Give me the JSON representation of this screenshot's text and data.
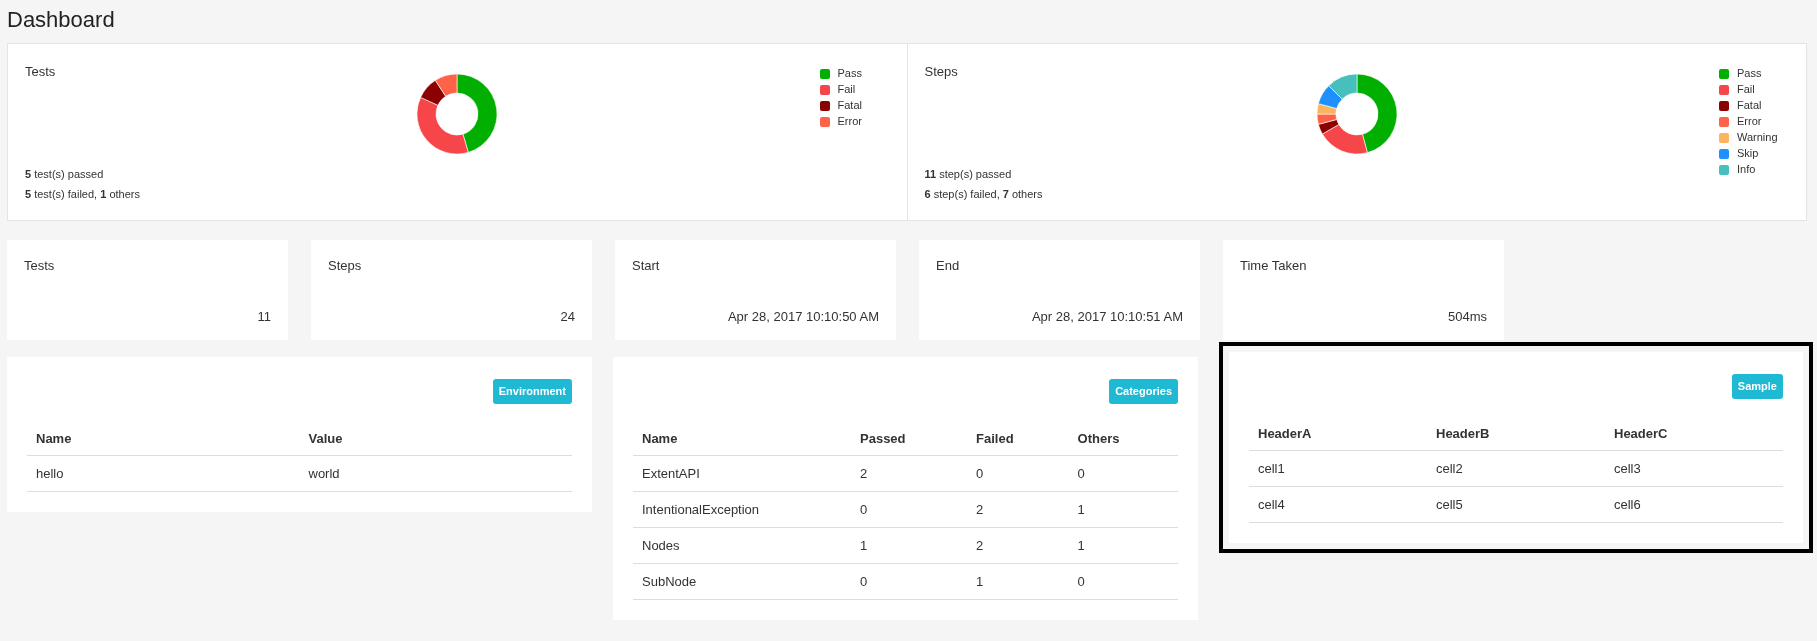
{
  "page_title": "Dashboard",
  "charts": [
    {
      "title": "Tests",
      "summary": [
        "**5** test(s) passed",
        "**5** test(s) failed, **1** others"
      ],
      "chart_data": {
        "type": "donut",
        "categories": [
          "Pass",
          "Fail",
          "Fatal",
          "Error"
        ],
        "values": [
          45.45,
          36.37,
          9.09,
          9.09
        ],
        "colors": [
          "#00af00",
          "#f7464a",
          "#8b0000",
          "#ff6347"
        ]
      }
    },
    {
      "title": "Steps",
      "summary": [
        "**11** step(s) passed",
        "**6** step(s) failed, **7** others"
      ],
      "chart_data": {
        "type": "donut",
        "categories": [
          "Pass",
          "Fail",
          "Fatal",
          "Error",
          "Warning",
          "Skip",
          "Info"
        ],
        "values": [
          45.83,
          20.83,
          4.17,
          4.17,
          4.17,
          8.33,
          12.5
        ],
        "colors": [
          "#00af00",
          "#f7464a",
          "#8b0000",
          "#ff6347",
          "#fdb45c",
          "#1e90ff",
          "#46bfbd"
        ]
      }
    }
  ],
  "stats": [
    {
      "label": "Tests",
      "value": "11"
    },
    {
      "label": "Steps",
      "value": "24"
    },
    {
      "label": "Start",
      "value": "Apr 28, 2017 10:10:50 AM"
    },
    {
      "label": "End",
      "value": "Apr 28, 2017 10:10:51 AM"
    },
    {
      "label": "Time Taken",
      "value": "504ms"
    }
  ],
  "tables": [
    {
      "badge": "Environment",
      "highlighted": false,
      "columns": [
        "Name",
        "Value"
      ],
      "rows": [
        [
          "hello",
          "world"
        ]
      ]
    },
    {
      "badge": "Categories",
      "highlighted": false,
      "columns": [
        "Name",
        "Passed",
        "Failed",
        "Others"
      ],
      "rows": [
        [
          "ExtentAPI",
          "2",
          "0",
          "0"
        ],
        [
          "IntentionalException",
          "0",
          "2",
          "1"
        ],
        [
          "Nodes",
          "1",
          "2",
          "1"
        ],
        [
          "SubNode",
          "0",
          "1",
          "0"
        ]
      ]
    },
    {
      "badge": "Sample",
      "highlighted": true,
      "columns": [
        "HeaderA",
        "HeaderB",
        "HeaderC"
      ],
      "rows": [
        [
          "cell1",
          "cell2",
          "cell3"
        ],
        [
          "cell4",
          "cell5",
          "cell6"
        ]
      ]
    }
  ]
}
